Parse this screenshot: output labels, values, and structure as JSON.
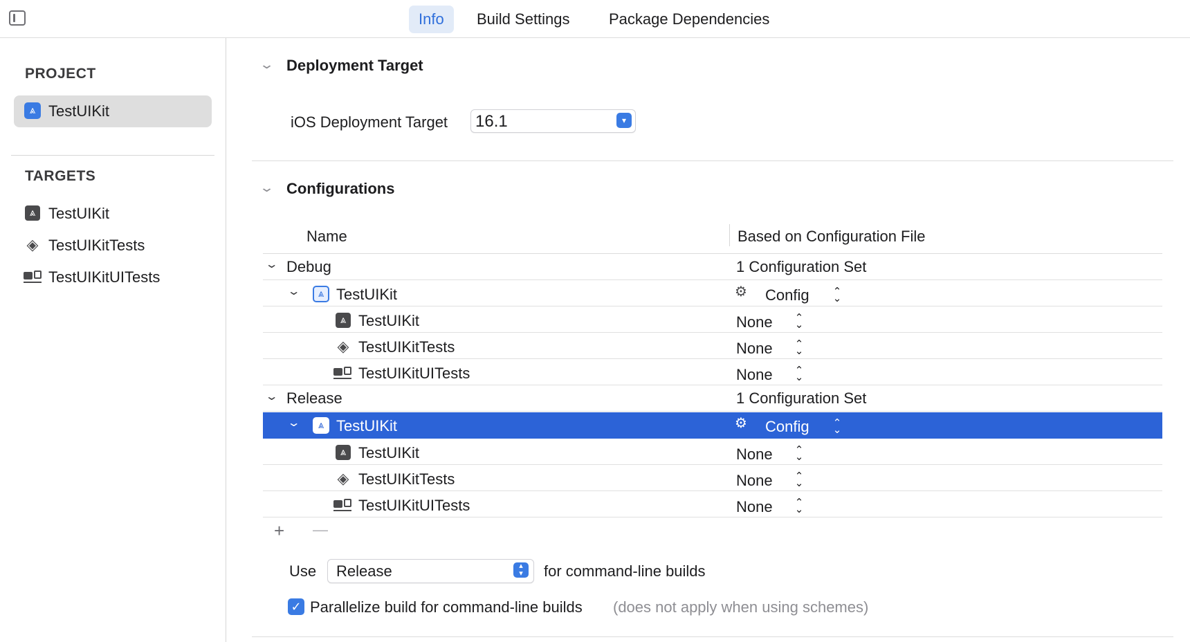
{
  "tabs": [
    {
      "label": "Info",
      "active": true
    },
    {
      "label": "Build Settings",
      "active": false
    },
    {
      "label": "Package Dependencies",
      "active": false
    }
  ],
  "sidebar": {
    "project_title": "PROJECT",
    "project_item": "TestUIKit",
    "targets_title": "TARGETS",
    "targets": [
      "TestUIKit",
      "TestUIKitTests",
      "TestUIKitUITests"
    ]
  },
  "deployment": {
    "section_title": "Deployment Target",
    "label": "iOS Deployment Target",
    "value": "16.1"
  },
  "configurations": {
    "section_title": "Configurations",
    "col_name": "Name",
    "col_file": "Based on Configuration File",
    "groups": [
      {
        "name": "Debug",
        "summary": "1 Configuration Set",
        "project": {
          "name": "TestUIKit",
          "file": "Config"
        },
        "targets": [
          {
            "name": "TestUIKit",
            "file": "None"
          },
          {
            "name": "TestUIKitTests",
            "file": "None"
          },
          {
            "name": "TestUIKitUITests",
            "file": "None"
          }
        ]
      },
      {
        "name": "Release",
        "summary": "1 Configuration Set",
        "project": {
          "name": "TestUIKit",
          "file": "Config",
          "selected": true
        },
        "targets": [
          {
            "name": "TestUIKit",
            "file": "None"
          },
          {
            "name": "TestUIKitTests",
            "file": "None"
          },
          {
            "name": "TestUIKitUITests",
            "file": "None"
          }
        ]
      }
    ],
    "add_symbol": "+",
    "remove_symbol": "—"
  },
  "cmdline": {
    "use_label": "Use",
    "use_value": "Release",
    "suffix": "for command-line builds",
    "parallelize_label": "Parallelize build for command-line builds",
    "parallelize_note": "(does not apply when using schemes)",
    "parallelize_checked": true
  },
  "colors": {
    "accent": "#3a7be3",
    "selection": "#2c63d7",
    "active_tab_bg": "#e2ebf8"
  }
}
